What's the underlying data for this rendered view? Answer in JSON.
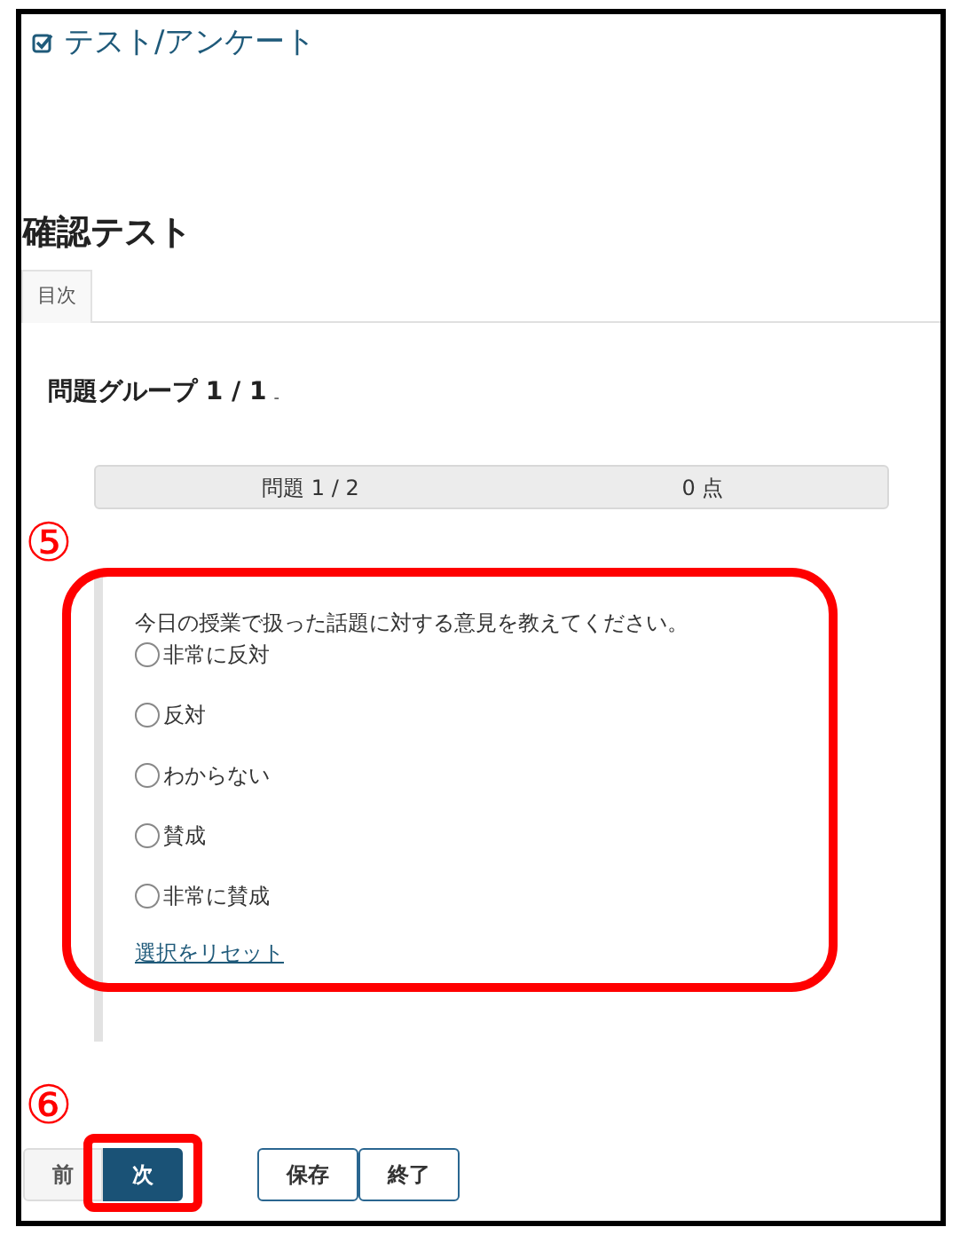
{
  "header": {
    "title": "テスト/アンケート"
  },
  "test_title": "確認テスト",
  "tabs": [
    {
      "label": "目次",
      "selected": true
    }
  ],
  "group_heading": {
    "label": "問題グループ 1 / 1",
    "suffix": "-"
  },
  "question_bar": {
    "number": "問題 1 / 2",
    "points": "0 点"
  },
  "question": {
    "text": "今日の授業で扱った話題に対する意見を教えてください。",
    "options": [
      {
        "label": "非常に反対",
        "selected": false
      },
      {
        "label": "反対",
        "selected": false
      },
      {
        "label": "わからない",
        "selected": false
      },
      {
        "label": "賛成",
        "selected": false
      },
      {
        "label": "非常に賛成",
        "selected": false
      }
    ],
    "reset_link": "選択をリセット"
  },
  "buttons": [
    {
      "label": "前",
      "kind": "plain"
    },
    {
      "label": "次",
      "kind": "primary"
    },
    {
      "label": "保存",
      "kind": "outline"
    },
    {
      "label": "終了",
      "kind": "outline"
    }
  ],
  "annotations": [
    {
      "label": "⑤",
      "kind": "panel"
    },
    {
      "label": "⑥",
      "kind": "button"
    }
  ]
}
